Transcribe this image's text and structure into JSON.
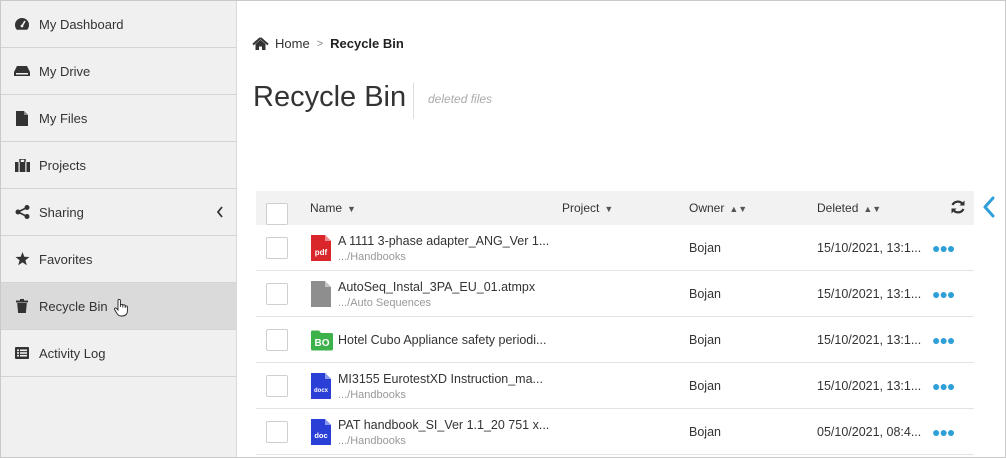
{
  "sidebar": {
    "items": [
      {
        "label": "My Dashboard",
        "icon": "dashboard-icon"
      },
      {
        "label": "My Drive",
        "icon": "drive-icon"
      },
      {
        "label": "My Files",
        "icon": "file-icon"
      },
      {
        "label": "Projects",
        "icon": "projects-icon"
      },
      {
        "label": "Sharing",
        "icon": "share-icon"
      },
      {
        "label": "Favorites",
        "icon": "star-icon"
      },
      {
        "label": "Recycle Bin",
        "icon": "trash-icon"
      },
      {
        "label": "Activity Log",
        "icon": "list-icon"
      }
    ],
    "active_item": "Recycle Bin"
  },
  "breadcrumb": {
    "home": "Home",
    "current": "Recycle Bin"
  },
  "page": {
    "title": "Recycle Bin",
    "subtitle": "deleted files"
  },
  "table": {
    "columns": {
      "name": "Name",
      "project": "Project",
      "owner": "Owner",
      "deleted": "Deleted"
    },
    "rows": [
      {
        "name": "A 1111 3-phase adapter_ANG_Ver 1...",
        "path": ".../Handbooks",
        "owner": "Bojan",
        "deleted": "15/10/2021, 13:1...",
        "type": "pdf",
        "badge": "pdf"
      },
      {
        "name": "AutoSeq_Instal_3PA_EU_01.atmpx",
        "path": ".../Auto Sequences",
        "owner": "Bojan",
        "deleted": "15/10/2021, 13:1...",
        "type": "generic",
        "badge": ""
      },
      {
        "name": "Hotel Cubo Appliance safety periodi...",
        "path": "",
        "owner": "Bojan",
        "deleted": "15/10/2021, 13:1...",
        "type": "bo",
        "badge": "BO"
      },
      {
        "name": "MI3155 EurotestXD Instruction_ma...",
        "path": ".../Handbooks",
        "owner": "Bojan",
        "deleted": "15/10/2021, 13:1...",
        "type": "docx",
        "badge": "docx"
      },
      {
        "name": "PAT handbook_SI_Ver 1.1_20 751 x...",
        "path": ".../Handbooks",
        "owner": "Bojan",
        "deleted": "05/10/2021, 08:4...",
        "type": "doc",
        "badge": "doc"
      }
    ]
  },
  "colors": {
    "accent": "#2f9fd8",
    "pdf": "#d9262b",
    "docx": "#2a3fd6",
    "bo": "#3db24a",
    "generic": "#8e8e8e"
  }
}
